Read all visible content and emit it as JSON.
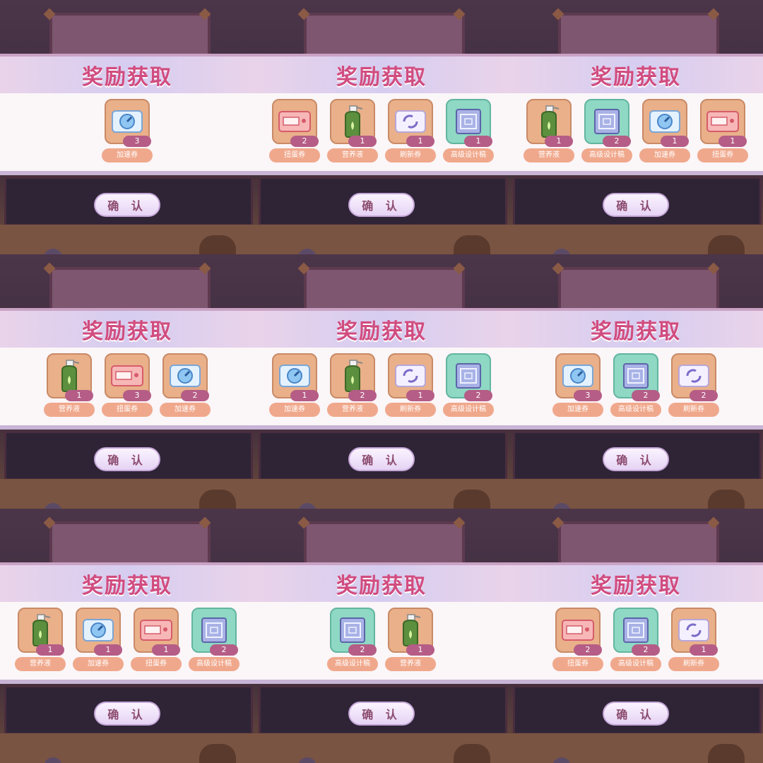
{
  "screens": [
    {
      "title": "奖励获取",
      "confirm": "确 认",
      "rewards": [
        {
          "icon": "speedup-ticket-icon",
          "label": "加速券",
          "qty": "3"
        }
      ]
    },
    {
      "title": "奖励获取",
      "confirm": "确 认",
      "rewards": [
        {
          "icon": "gacha-ticket-icon",
          "label": "扭蛋券",
          "qty": "2"
        },
        {
          "icon": "nutrient-bottle-icon",
          "label": "营养液",
          "qty": "1"
        },
        {
          "icon": "refresh-ticket-icon",
          "label": "刷新券",
          "qty": "1"
        },
        {
          "icon": "blueprint-scroll-icon",
          "label": "高级设计稿",
          "qty": "1"
        }
      ]
    },
    {
      "title": "奖励获取",
      "confirm": "确 认",
      "rewards": [
        {
          "icon": "nutrient-bottle-icon",
          "label": "营养液",
          "qty": "1"
        },
        {
          "icon": "blueprint-scroll-icon",
          "label": "高级设计稿",
          "qty": "2"
        },
        {
          "icon": "speedup-ticket-icon",
          "label": "加速券",
          "qty": "1"
        },
        {
          "icon": "gacha-ticket-icon",
          "label": "扭蛋券",
          "qty": "1"
        }
      ]
    },
    {
      "title": "奖励获取",
      "confirm": "确 认",
      "rewards": [
        {
          "icon": "nutrient-bottle-icon",
          "label": "营养液",
          "qty": "1"
        },
        {
          "icon": "gacha-ticket-icon",
          "label": "扭蛋券",
          "qty": "3"
        },
        {
          "icon": "speedup-ticket-icon",
          "label": "加速券",
          "qty": "2"
        }
      ]
    },
    {
      "title": "奖励获取",
      "confirm": "确 认",
      "rewards": [
        {
          "icon": "speedup-ticket-icon",
          "label": "加速券",
          "qty": "1"
        },
        {
          "icon": "nutrient-bottle-icon",
          "label": "营养液",
          "qty": "2"
        },
        {
          "icon": "refresh-ticket-icon",
          "label": "刷新券",
          "qty": "1"
        },
        {
          "icon": "blueprint-scroll-icon",
          "label": "高级设计稿",
          "qty": "2"
        }
      ]
    },
    {
      "title": "奖励获取",
      "confirm": "确 认",
      "rewards": [
        {
          "icon": "speedup-ticket-icon",
          "label": "加速券",
          "qty": "3"
        },
        {
          "icon": "blueprint-scroll-icon",
          "label": "高级设计稿",
          "qty": "2"
        },
        {
          "icon": "refresh-ticket-icon",
          "label": "刷新券",
          "qty": "2"
        }
      ]
    },
    {
      "title": "奖励获取",
      "confirm": "确 认",
      "rewards": [
        {
          "icon": "nutrient-bottle-icon",
          "label": "营养液",
          "qty": "1"
        },
        {
          "icon": "speedup-ticket-icon",
          "label": "加速券",
          "qty": "1"
        },
        {
          "icon": "gacha-ticket-icon",
          "label": "扭蛋券",
          "qty": "1"
        },
        {
          "icon": "blueprint-scroll-icon",
          "label": "高级设计稿",
          "qty": "2"
        }
      ]
    },
    {
      "title": "奖励获取",
      "confirm": "确 认",
      "rewards": [
        {
          "icon": "blueprint-scroll-icon",
          "label": "高级设计稿",
          "qty": "2"
        },
        {
          "icon": "nutrient-bottle-icon",
          "label": "营养液",
          "qty": "1"
        }
      ]
    },
    {
      "title": "奖励获取",
      "confirm": "确 认",
      "rewards": [
        {
          "icon": "gacha-ticket-icon",
          "label": "扭蛋券",
          "qty": "2"
        },
        {
          "icon": "blueprint-scroll-icon",
          "label": "高级设计稿",
          "qty": "2"
        },
        {
          "icon": "refresh-ticket-icon",
          "label": "刷新券",
          "qty": "1"
        }
      ]
    }
  ],
  "colors": {
    "title": "#d14c7f",
    "tile": "#e9b08a",
    "rare_tile": "#8ed8c4",
    "qty_badge": "#b55d86",
    "label_pill": "#f0a88c"
  }
}
